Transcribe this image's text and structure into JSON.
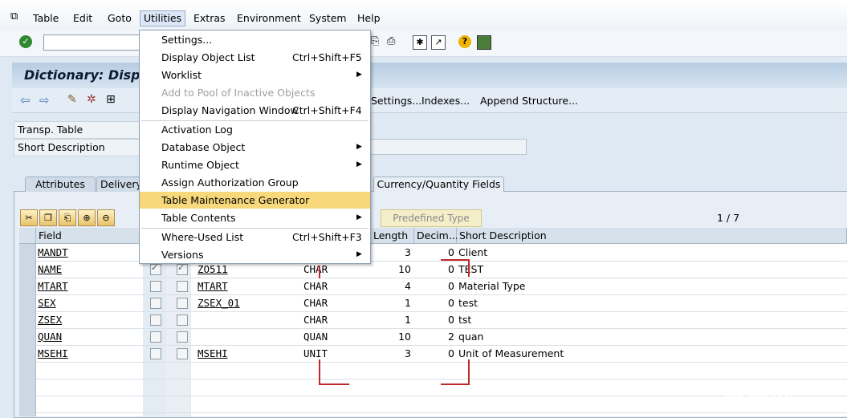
{
  "menubar": {
    "items": [
      "Table",
      "Edit",
      "Goto",
      "Utilities",
      "Extras",
      "Environment",
      "System",
      "Help"
    ]
  },
  "page_title": "Dictionary: Displ",
  "app_toolbar": {
    "buttons": [
      "Settings...",
      "Indexes...",
      "Append Structure..."
    ]
  },
  "fields": {
    "transp_table_label": "Transp. Table",
    "short_description_label": "Short Description"
  },
  "tabs": [
    "Attributes",
    "Delivery",
    "Currency/Quantity Fields"
  ],
  "table_toolbar": {
    "predefined_type_button": "Predefined Type",
    "pager": "1 / 7"
  },
  "grid": {
    "headers": [
      "Field",
      "Length",
      "Decim...",
      "Short Description"
    ],
    "rows": [
      {
        "field": "MANDT",
        "key": false,
        "init": false,
        "element": "",
        "type": "",
        "length": "3",
        "decimals": "0",
        "desc": "Client"
      },
      {
        "field": "NAME",
        "key": true,
        "init": true,
        "element": "ZO511",
        "type": "CHAR",
        "length": "10",
        "decimals": "0",
        "desc": "TEST"
      },
      {
        "field": "MTART",
        "key": false,
        "init": false,
        "element": "MTART",
        "type": "CHAR",
        "length": "4",
        "decimals": "0",
        "desc": "Material Type"
      },
      {
        "field": "SEX",
        "key": false,
        "init": false,
        "element": "ZSEX_01",
        "type": "CHAR",
        "length": "1",
        "decimals": "0",
        "desc": "test"
      },
      {
        "field": "ZSEX",
        "key": false,
        "init": false,
        "element": "",
        "type": "CHAR",
        "length": "1",
        "decimals": "0",
        "desc": "tst"
      },
      {
        "field": "QUAN",
        "key": false,
        "init": false,
        "element": "",
        "type": "QUAN",
        "length": "10",
        "decimals": "2",
        "desc": "quan"
      },
      {
        "field": "MSEHI",
        "key": false,
        "init": false,
        "element": "MSEHI",
        "type": "UNIT",
        "length": "3",
        "decimals": "0",
        "desc": "Unit of Measurement"
      }
    ]
  },
  "dropdown": {
    "items": [
      {
        "label": "Settings...",
        "shortcut": "",
        "submenu": false,
        "disabled": false
      },
      {
        "label": "Display Object List",
        "shortcut": "Ctrl+Shift+F5",
        "submenu": false,
        "disabled": false
      },
      {
        "label": "Worklist",
        "shortcut": "",
        "submenu": true,
        "disabled": false
      },
      {
        "label": "Add to Pool of Inactive Objects",
        "shortcut": "",
        "submenu": false,
        "disabled": true
      },
      {
        "label": "Display Navigation Window",
        "shortcut": "Ctrl+Shift+F4",
        "submenu": false,
        "disabled": false
      },
      {
        "label": "Activation Log",
        "shortcut": "",
        "submenu": false,
        "disabled": false
      },
      {
        "label": "Database Object",
        "shortcut": "",
        "submenu": true,
        "disabled": false
      },
      {
        "label": "Runtime Object",
        "shortcut": "",
        "submenu": true,
        "disabled": false
      },
      {
        "label": "Assign Authorization Group",
        "shortcut": "",
        "submenu": false,
        "disabled": false
      },
      {
        "label": "Table Maintenance Generator",
        "shortcut": "",
        "submenu": false,
        "disabled": false,
        "highlighted": true
      },
      {
        "label": "Table Contents",
        "shortcut": "",
        "submenu": true,
        "disabled": false
      },
      {
        "label": "Where-Used List",
        "shortcut": "Ctrl+Shift+F3",
        "submenu": false,
        "disabled": false
      },
      {
        "label": "Versions",
        "shortcut": "",
        "submenu": true,
        "disabled": false
      }
    ]
  },
  "watermark": {
    "text": "赛跑网",
    "url": "www.51sao.com"
  },
  "colors": {
    "highlight": "#f7d97c",
    "title_bg": "#b6cde3",
    "annotation_red": "#c0282a"
  }
}
